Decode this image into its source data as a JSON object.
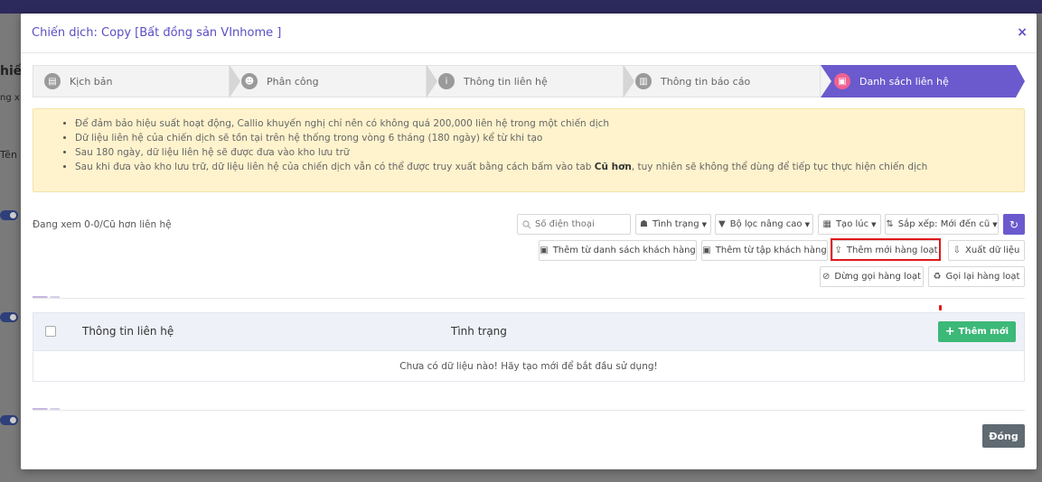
{
  "modal": {
    "title": "Chiến dịch: Copy [Bất đồng sản VInhome ]",
    "close_icon": "×"
  },
  "steps": [
    {
      "label": "Kịch bản",
      "icon": "file-icon",
      "glyph": "▤"
    },
    {
      "label": "Phân công",
      "icon": "users-icon",
      "glyph": "☻"
    },
    {
      "label": "Thông tin liên hệ",
      "icon": "info-icon",
      "glyph": "i"
    },
    {
      "label": "Thông tin báo cáo",
      "icon": "chart-icon",
      "glyph": "▥"
    },
    {
      "label": "Danh sách liên hệ",
      "icon": "contact-icon",
      "glyph": "▣"
    }
  ],
  "notice": {
    "items": [
      "Để đảm bảo hiệu suất hoạt động, Callio khuyến nghị chỉ nên có không quá 200,000 liên hệ trong một chiến dịch",
      "Dữ liệu liên hệ của chiến dịch sẽ tồn tại trên hệ thống trong vòng 6 tháng (180 ngày) kể từ khi tạo",
      "Sau 180 ngày, dữ liệu liên hệ sẽ được đưa vào kho lưu trữ",
      "Sau khi đưa vào kho lưu trữ, dữ liệu liên hệ của chiến dịch vẫn có thể được truy xuất bằng cách bấm vào tab "
    ],
    "last_bold": "Cũ hơn",
    "last_tail": ", tuy nhiên sẽ không thể dùng để tiếp tục thực hiện chiến dịch"
  },
  "showing_text": "Đang xem 0-0/Cũ hơn liên hệ",
  "filters": {
    "search_placeholder": "Số điện thoại",
    "status_label": "Tình trạng",
    "advanced_filter_label": "Bộ lọc nâng cao",
    "created_label": "Tạo lúc",
    "sort_label": "Sắp xếp: Mới đến cũ"
  },
  "actions": {
    "add_from_customer_list": "Thêm từ danh sách khách hàng",
    "add_from_customer_set": "Thêm từ tập khách hàng",
    "bulk_add": "Thêm mới hàng loạt",
    "export": "Xuất dữ liệu",
    "stop_bulk_call": "Dừng gọi hàng loạt",
    "recall_bulk": "Gọi lại hàng loạt"
  },
  "table": {
    "col_contact": "Thông tin liên hệ",
    "col_status": "Tình trạng",
    "add_button": "Thêm mới",
    "empty_text": "Chưa có dữ liệu nào! Hãy tạo mới để bắt đầu sử dụng!"
  },
  "footer": {
    "close_label": "Đóng"
  },
  "background": {
    "left_heading": "hiến",
    "left_sub": "ng x",
    "left_col": "Tên"
  },
  "colors": {
    "accent": "#6a5acd",
    "active_step_icon": "#f06292",
    "success": "#3cb878",
    "highlight": "#e01919",
    "notice_bg": "#fff3cd"
  }
}
